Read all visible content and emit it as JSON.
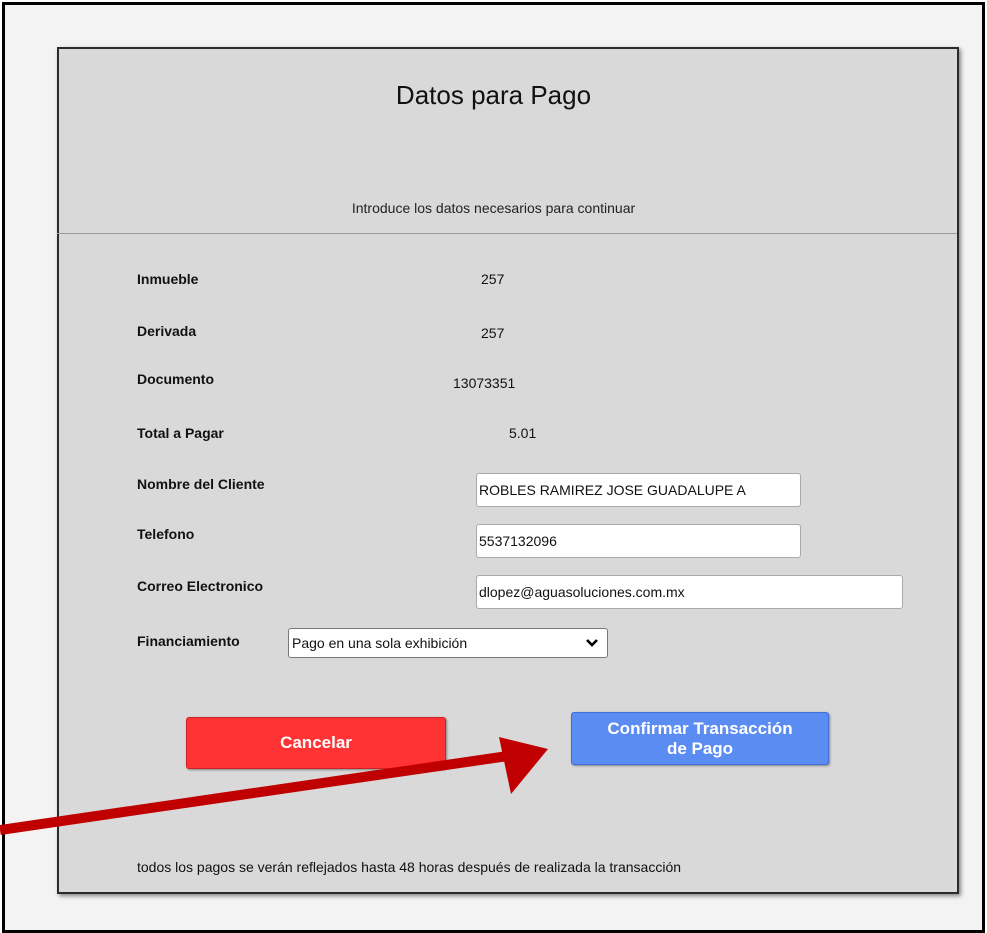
{
  "header": {
    "title": "Datos para Pago",
    "subtitle": "Introduce los datos necesarios para continuar"
  },
  "fields": {
    "inmueble": {
      "label": "Inmueble",
      "value": "257"
    },
    "derivada": {
      "label": "Derivada",
      "value": "257"
    },
    "documento": {
      "label": "Documento",
      "value": "13073351"
    },
    "total": {
      "label": "Total a Pagar",
      "value": "5.01"
    },
    "nombre": {
      "label": "Nombre del Cliente",
      "value": "ROBLES RAMIREZ JOSE GUADALUPE A"
    },
    "telefono": {
      "label": "Telefono",
      "value": "5537132096"
    },
    "correo": {
      "label": "Correo Electronico",
      "value": "dlopez@aguasoluciones.com.mx"
    },
    "financiamiento": {
      "label": "Financiamiento",
      "selected": "Pago en una sola exhibición"
    }
  },
  "buttons": {
    "cancel": "Cancelar",
    "confirm_line1": "Confirmar Transacción",
    "confirm_line2": "de Pago"
  },
  "footer": "todos los pagos se verán reflejados hasta 48 horas después de realizada la transacción",
  "colors": {
    "cancel": "#ff3333",
    "confirm": "#5b8cf2",
    "arrow": "#c00000",
    "card": "#d9d9d9"
  },
  "icons": {
    "select_chevron": "chevron-down-icon",
    "annotation": "arrow-icon"
  }
}
